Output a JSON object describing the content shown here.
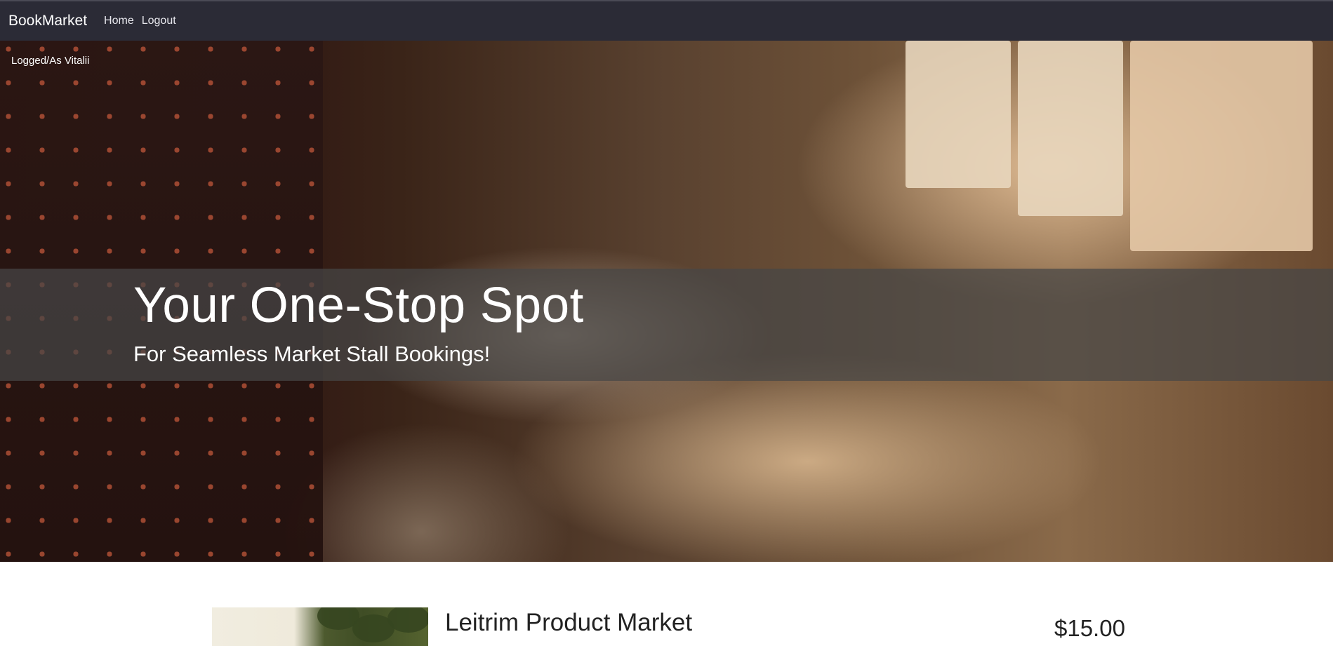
{
  "navbar": {
    "brand": "BookMarket",
    "links": [
      "Home",
      "Logout"
    ]
  },
  "hero": {
    "logged_in_text": "Logged/As Vitalii",
    "title": "Your One-Stop Spot",
    "subtitle": "For Seamless Market Stall Bookings!"
  },
  "listing": {
    "title": "Leitrim Product Market",
    "price": "$15.00"
  },
  "colors": {
    "navbar_bg": "#2b2b36",
    "banner_overlay": "rgba(70,70,70,0.72)",
    "text_light": "#ffffff",
    "text_dark": "#222222"
  }
}
